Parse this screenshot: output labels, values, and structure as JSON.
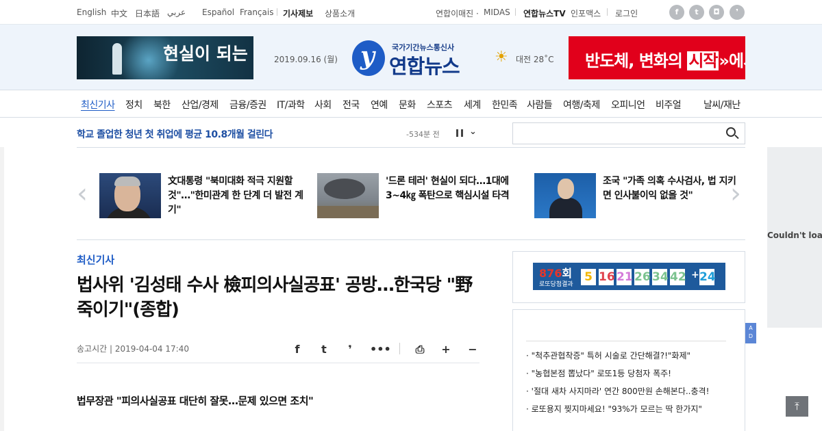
{
  "topbar": {
    "languages": [
      "English",
      "中文",
      "日本語",
      "عربي",
      "Español",
      "Français"
    ],
    "report_label": "기사제보",
    "products_label": "상품소개",
    "image_label": "연합이매진 ·",
    "midas_label": "MIDAS",
    "tv_label": "연합뉴스TV",
    "infomax_label": "인포맥스",
    "login_label": "로그인",
    "social_icons": [
      "facebook-icon",
      "twitter-icon",
      "instagram-icon",
      "yonhap-icon"
    ]
  },
  "header": {
    "banner_left_text": "현실이 되는",
    "date": "2019.09.16 (월)",
    "logo_sub": "국가기간뉴스통신사",
    "logo_name": "연합뉴스",
    "weather": "대전 28˚C",
    "banner_right_pre": "반도체, 변화의 ",
    "banner_right_hl": "시작",
    "banner_right_post": "에서"
  },
  "nav": {
    "items": [
      "최신기사",
      "정치",
      "북한",
      "산업/경제",
      "금융/증권",
      "IT/과학",
      "사회",
      "전국",
      "연예",
      "문화",
      "스포츠",
      "세계",
      "한민족",
      "사람들",
      "여행/축제",
      "오피니언",
      "비주얼",
      "날씨/재난"
    ]
  },
  "ticker": {
    "headline": "학교 졸업한 청년 첫 취업에 평균 10.8개월 걸린다",
    "time": "-534분 전"
  },
  "search": {
    "placeholder": ""
  },
  "right_ad": {
    "text": "Couldn't load"
  },
  "carousel": [
    {
      "title": "文대통령 \"북미대화 적극 지원할 것\"…\"한미관계 한 단계 더 발전 계기\""
    },
    {
      "title": "'드론 테러' 현실이 되다…1대에 3~4㎏ 폭탄으로 핵심시설 타격"
    },
    {
      "title": "조국 \"가족 의혹 수사검사, 법 지키면 인사불이익 없을 것\""
    }
  ],
  "article": {
    "section": "최신기사",
    "title": "법사위 '김성태 수사 檢피의사실공표' 공방…한국당 \"野 죽이기\"(종합)",
    "send_time": "송고시간 | 2019-04-04 17:40",
    "subhead": "법무장관 \"피의사실공표 대단히 잘못…문제 있으면 조치\""
  },
  "lotto": {
    "round": "876",
    "round_suffix": "회",
    "label": "로또당첨결과",
    "numbers": [
      "5",
      "16",
      "21",
      "26",
      "34",
      "42"
    ],
    "bonus": "24",
    "colors": [
      "#f2b600",
      "#e0424d",
      "#d47ad9",
      "#7cc38f",
      "#7cc38f",
      "#7cc38f",
      "#1f9ed9"
    ]
  },
  "ads": {
    "items": [
      "\"척추관협착증\" 특허 시술로 간단해결?!\"화제\"",
      "\"농협본점 뽑났다\" 로또1등 당첨자 폭주!",
      "'절대 새차 사지마라' 연간 800만원 손해본다..충격!",
      "로또용지 찢지마세요! \"93%가 모르는 딱 한가지\""
    ],
    "badge": "AD"
  },
  "colors": {
    "accent": "#1e5cc6",
    "brand_red": "#e1001b"
  }
}
